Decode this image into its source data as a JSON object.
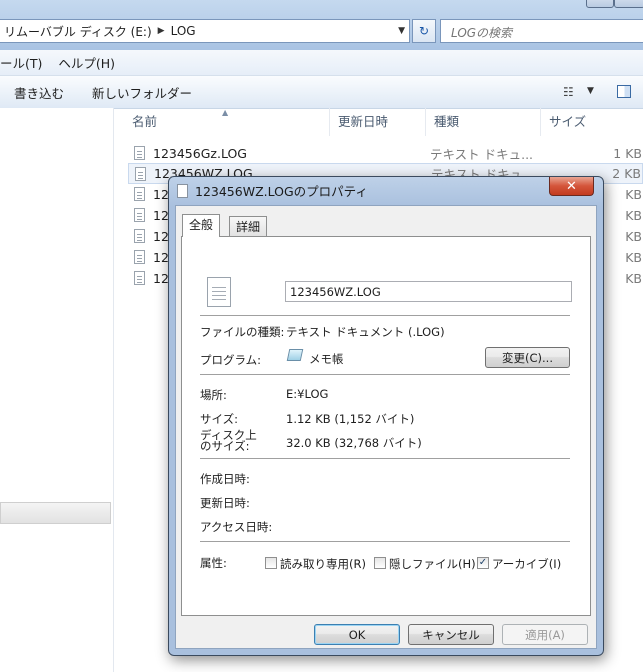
{
  "explorer": {
    "address": {
      "segments": [
        "リムーバブル ディスク (E:)",
        "LOG"
      ]
    },
    "search_placeholder": "LOGの検索",
    "menu": [
      "ール(T)",
      "ヘルプ(H)"
    ],
    "toolbar": [
      "書き込む",
      "新しいフォルダー"
    ],
    "columns": {
      "name": "名前",
      "modified": "更新日時",
      "type": "種類",
      "size": "サイズ"
    },
    "files": [
      {
        "name": "123456Gz.LOG",
        "type": "テキスト ドキュ...",
        "size": "1 KB"
      },
      {
        "name": "123456WZ.LOG",
        "type": "テキスト ドキュ...",
        "size": "2 KB"
      },
      {
        "name": "12",
        "type": "",
        "size": "KB"
      },
      {
        "name": "12",
        "type": "",
        "size": "KB"
      },
      {
        "name": "12",
        "type": "",
        "size": "KB"
      },
      {
        "name": "12",
        "type": "",
        "size": "KB"
      },
      {
        "name": "12",
        "type": "",
        "size": "KB"
      }
    ]
  },
  "dialog": {
    "title": "123456WZ.LOGのプロパティ",
    "close_label": "✕",
    "tabs": [
      "全般",
      "詳細"
    ],
    "filename": "123456WZ.LOG",
    "file_type_label": "ファイルの種類:",
    "file_type_value": "テキスト ドキュメント (.LOG)",
    "program_label": "プログラム:",
    "program_value": "メモ帳",
    "change_button": "変更(C)...",
    "location_label": "場所:",
    "location_value": "E:¥LOG",
    "size_label": "サイズ:",
    "size_value": "1.12 KB (1,152 バイト)",
    "disk_size_label_line1": "ディスク上",
    "disk_size_label_line2": "のサイズ:",
    "disk_size_value": "32.0 KB (32,768 バイト)",
    "created_label": "作成日時:",
    "modified_label": "更新日時:",
    "accessed_label": "アクセス日時:",
    "attributes_label": "属性:",
    "attributes": [
      {
        "label": "読み取り専用(R)",
        "checked": false
      },
      {
        "label": "隠しファイル(H)",
        "checked": false
      },
      {
        "label": "アーカイブ(I)",
        "checked": true
      }
    ],
    "ok_button": "OK",
    "cancel_button": "キャンセル",
    "apply_button": "適用(A)"
  }
}
